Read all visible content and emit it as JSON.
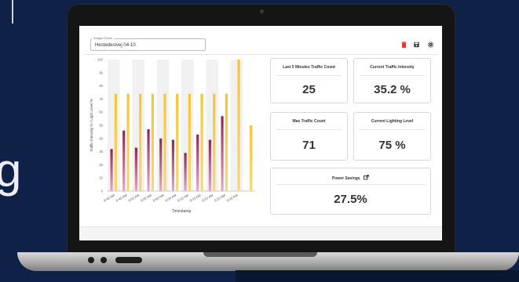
{
  "background": {
    "partial_letter": "g"
  },
  "widget": {
    "legend": "Widget Name",
    "value": "Hestedestvej 04-10"
  },
  "toolbar": {
    "delete_icon": "trash-icon",
    "save_icon": "floppy-icon",
    "settings_icon": "gear-icon"
  },
  "cards": {
    "last5": {
      "title": "Last 5 Minutes Traffic Count",
      "value": "25"
    },
    "intensity": {
      "title": "Current Traffic Intensity",
      "value": "35.2 %"
    },
    "max": {
      "title": "Max Traffic Count",
      "value": "71"
    },
    "lighting": {
      "title": "Current Lighting Level",
      "value": "75 %"
    },
    "power": {
      "title": "Power Savings",
      "value": "27.5%",
      "icon": "external-link-icon"
    }
  },
  "colors": {
    "traffic": "#8f2450",
    "light": "#f5c531",
    "bezel": "#151515",
    "background": "#0f2146"
  },
  "chart_data": {
    "type": "bar",
    "ylabel": "Traffic Intensity % / Light Level %",
    "xlabel": "Timestamp",
    "ylim": [
      0,
      100
    ],
    "yticks": [
      0,
      10,
      20,
      30,
      40,
      50,
      60,
      70,
      80,
      90,
      100
    ],
    "categories": [
      "9:40 AM",
      "9:45 AM",
      "9:50 AM",
      "9:55 AM",
      "9:60 AM",
      "9:05 AM",
      "9:10 AM",
      "9:15 AM",
      "9:20 AM",
      "9:25 AM",
      "9:30 AM",
      "9:35 AM"
    ],
    "xtick_labels": [
      "9:40 AM",
      "9:45 AM",
      "9:50 AM",
      "9:55 AM",
      "9:60 AM",
      "9:05 AM",
      "9:10 AM",
      "9:15 AM",
      "9:20 AM",
      "9:25 AM",
      "9:30 AM"
    ],
    "series": [
      {
        "values": [
          32,
          46,
          33,
          47,
          40,
          39,
          29,
          43,
          39,
          57,
          0
        ]
      },
      {
        "values": [
          74,
          74,
          74,
          74,
          74,
          74,
          74,
          74,
          74,
          74,
          100,
          50
        ]
      }
    ]
  }
}
